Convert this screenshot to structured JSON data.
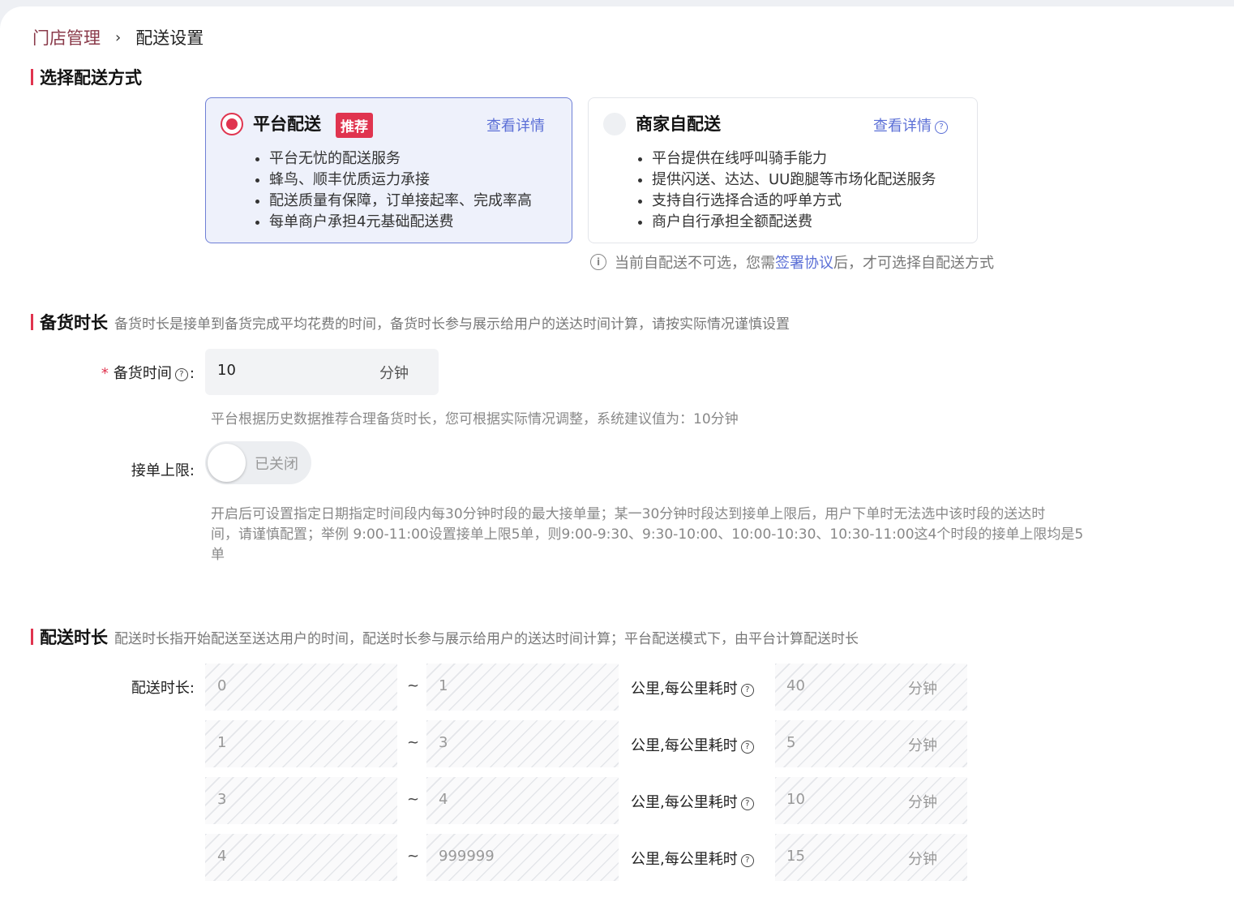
{
  "breadcrumb": {
    "parent": "门店管理",
    "separator": "›",
    "current": "配送设置"
  },
  "delivery_method": {
    "title": "选择配送方式",
    "options": [
      {
        "title": "平台配送",
        "badge": "推荐",
        "detail_link": "查看详情",
        "selected": true,
        "bullets": [
          "平台无忧的配送服务",
          "蜂鸟、顺丰优质运力承接",
          "配送质量有保障，订单接起率、完成率高",
          "每单商户承担4元基础配送费"
        ]
      },
      {
        "title": "商家自配送",
        "detail_link": "查看详情",
        "selected": false,
        "bullets": [
          "平台提供在线呼叫骑手能力",
          "提供闪送、达达、UU跑腿等市场化配送服务",
          "支持自行选择合适的呼单方式",
          "商户自行承担全额配送费"
        ]
      }
    ],
    "notice": {
      "before": "当前自配送不可选，您需",
      "link": "签署协议",
      "after": "后，才可选择自配送方式"
    }
  },
  "prep_time": {
    "title": "备货时长",
    "description": "备货时长是接单到备货完成平均花费的时间，备货时长参与展示给用户的送达时间计算，请按实际情况谨慎设置",
    "field_label": "备货时间",
    "required_mark": "*",
    "value": "10",
    "unit": "分钟",
    "hint": "平台根据历史数据推荐合理备货时长，您可根据实际情况调整，系统建议值为：10分钟",
    "limit_label": "接单上限",
    "limit_toggle_text": "已关闭",
    "limit_enabled": false,
    "limit_hint": [
      "开启后可设置指定日期指定时间段内每30分钟时段的最大接单量；某一30分钟时段达到接单上限后，用户下单时无法选中该时段的送达时",
      "间，请谨慎配置；举例 9:00-11:00设置接单上限5单，则9:00-9:30、9:30-10:00、10:00-10:30、10:30-11:00这4个时段的接单上限均是5",
      "单"
    ]
  },
  "delivery_time": {
    "title": "配送时长",
    "description": "配送时长指开始配送至送达用户的时间，配送时长参与展示给用户的送达时间计算；平台配送模式下，由平台计算配送时长",
    "field_label": "配送时长",
    "tilde": "~",
    "per_km_label": "公里,每公里耗时",
    "unit": "分钟",
    "rows": [
      {
        "from": "0",
        "to": "1",
        "minutes": "40"
      },
      {
        "from": "1",
        "to": "3",
        "minutes": "5"
      },
      {
        "from": "3",
        "to": "4",
        "minutes": "10"
      },
      {
        "from": "4",
        "to": "999999",
        "minutes": "15"
      }
    ]
  },
  "colors": {
    "accent": "#e0344f",
    "link": "#5b6fd6",
    "selected_card_bg": "#eef1fb",
    "selected_card_border": "#6e7fd6"
  }
}
